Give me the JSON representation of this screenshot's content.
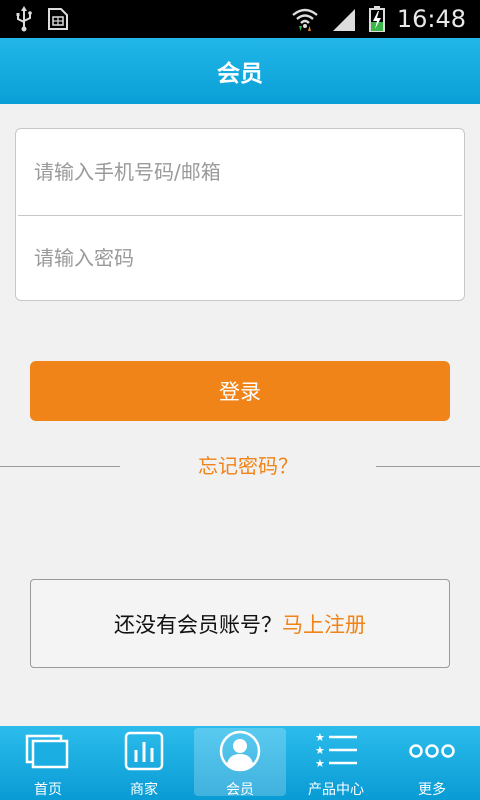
{
  "status_bar": {
    "time": "16:48",
    "icons": [
      "usb-icon",
      "sim-card-icon",
      "wifi-icon",
      "signal-icon",
      "battery-charging-icon"
    ]
  },
  "header": {
    "title": "会员"
  },
  "login_form": {
    "phone_placeholder": "请输入手机号码/邮箱",
    "password_placeholder": "请输入密码",
    "phone_value": "",
    "password_value": "",
    "login_label": "登录",
    "forgot_label": "忘记密码？"
  },
  "register": {
    "prompt": "还没有会员账号？",
    "link_label": "马上注册"
  },
  "bottom_nav": {
    "items": [
      {
        "label": "首页",
        "icon": "home-icon"
      },
      {
        "label": "商家",
        "icon": "merchant-icon"
      },
      {
        "label": "会员",
        "icon": "member-icon",
        "active": true
      },
      {
        "label": "产品中心",
        "icon": "product-list-icon"
      },
      {
        "label": "更多",
        "icon": "more-icon"
      }
    ]
  },
  "colors": {
    "accent_orange": "#f08418",
    "header_blue": "#0a9fd6",
    "background": "#f1f1f1"
  }
}
